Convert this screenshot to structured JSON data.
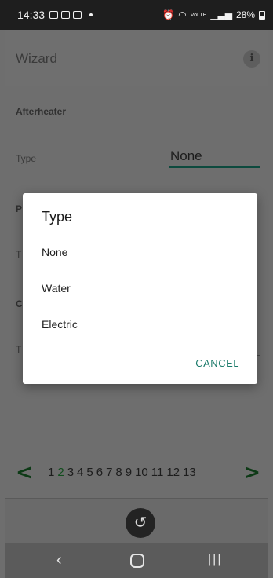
{
  "status_bar": {
    "time": "14:33",
    "battery": "28%",
    "signal_text": "VoLTE"
  },
  "app_bar": {
    "title": "Wizard",
    "info_icon": "info-icon"
  },
  "form": {
    "section": "Afterheater",
    "type_label": "Type",
    "type_value": "None",
    "hidden_fragments": [
      "P",
      "T",
      "C",
      "T"
    ]
  },
  "dialog": {
    "title": "Type",
    "options": [
      "None",
      "Water",
      "Electric"
    ],
    "cancel": "CANCEL"
  },
  "pager": {
    "prev": "<",
    "next": ">",
    "pages": [
      "1",
      "2",
      "3",
      "4",
      "5",
      "6",
      "7",
      "8",
      "9",
      "10",
      "11",
      "12",
      "13"
    ],
    "current_index": 1
  },
  "bottom": {
    "undo_icon": "undo-icon"
  },
  "nav": {
    "back": "‹",
    "recents": "|||"
  },
  "colors": {
    "accent": "#1a7a6a",
    "pager_arrow": "#0d3a16"
  }
}
